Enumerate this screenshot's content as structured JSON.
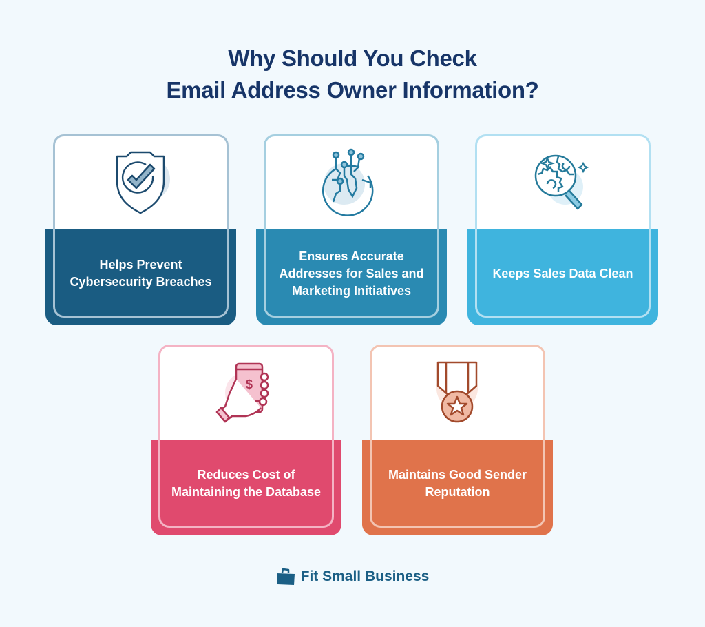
{
  "title": {
    "line1": "Why Should You Check",
    "line2": "Email Address Owner Information?"
  },
  "cards": [
    {
      "label": "Helps Prevent Cybersecurity Breaches",
      "icon": "shield-check-icon",
      "color": "#1a5c82",
      "outline": "#a6c2d4"
    },
    {
      "label": "Ensures Accurate Addresses for Sales and Marketing Initiatives",
      "icon": "globe-circuit-icon",
      "color": "#2a8ab2",
      "outline": "#a5cfe0"
    },
    {
      "label": "Keeps Sales Data Clean",
      "icon": "magnifier-gears-icon",
      "color": "#3fb4de",
      "outline": "#b2e0f2"
    },
    {
      "label": "Reduces Cost of Maintaining the Database",
      "icon": "hand-phone-dollar-icon",
      "color": "#e04a6e",
      "outline": "#f4b3c4"
    },
    {
      "label": "Maintains Good Sender Reputation",
      "icon": "medal-star-icon",
      "color": "#e0734b",
      "outline": "#f3c4b2"
    }
  ],
  "footer": {
    "brand": "Fit Small Business",
    "icon": "briefcase-icon"
  }
}
